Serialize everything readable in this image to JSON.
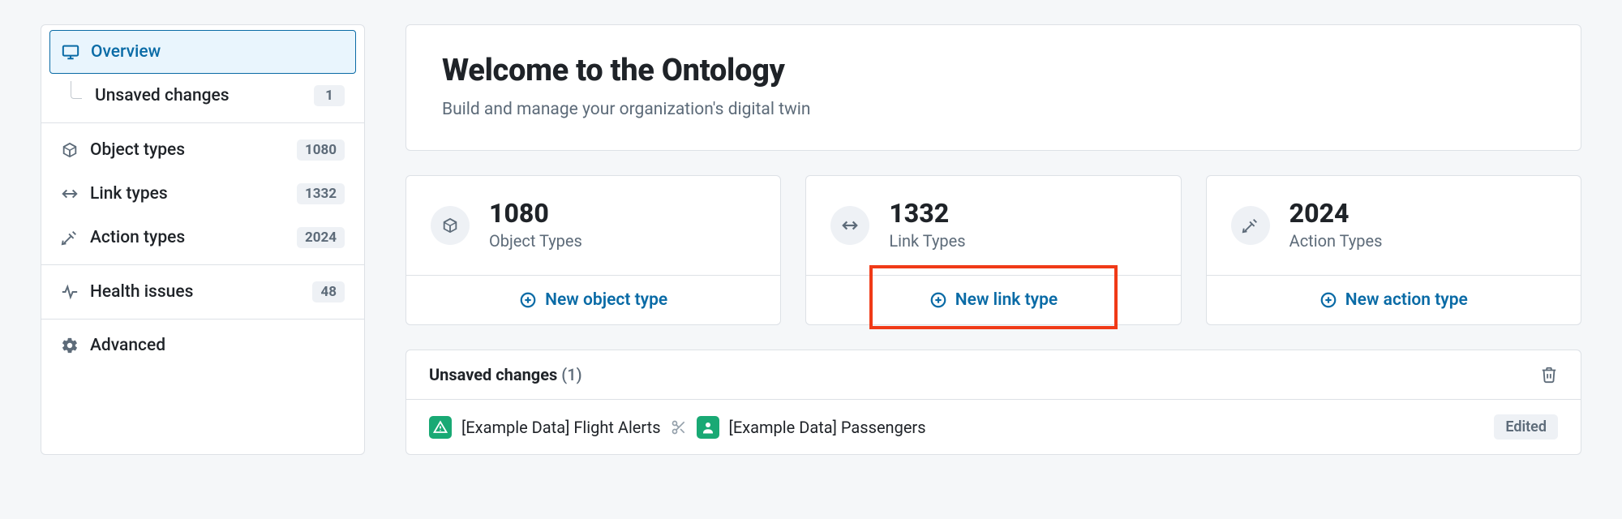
{
  "sidebar": {
    "overview": {
      "label": "Overview"
    },
    "unsaved_changes": {
      "label": "Unsaved changes",
      "count": "1"
    },
    "object_types": {
      "label": "Object types",
      "count": "1080"
    },
    "link_types": {
      "label": "Link types",
      "count": "1332"
    },
    "action_types": {
      "label": "Action types",
      "count": "2024"
    },
    "health_issues": {
      "label": "Health issues",
      "count": "48"
    },
    "advanced": {
      "label": "Advanced"
    }
  },
  "hero": {
    "title": "Welcome to the Ontology",
    "subtitle": "Build and manage your organization's digital twin"
  },
  "stats": {
    "object_types": {
      "count": "1080",
      "label": "Object Types",
      "action": "New object type"
    },
    "link_types": {
      "count": "1332",
      "label": "Link Types",
      "action": "New link type"
    },
    "action_types": {
      "count": "2024",
      "label": "Action Types",
      "action": "New action type"
    }
  },
  "unsaved_panel": {
    "title": "Unsaved changes",
    "count_display": "(1)",
    "row": {
      "item_a": "[Example Data] Flight Alerts",
      "item_b": "[Example Data] Passengers",
      "status": "Edited"
    }
  }
}
